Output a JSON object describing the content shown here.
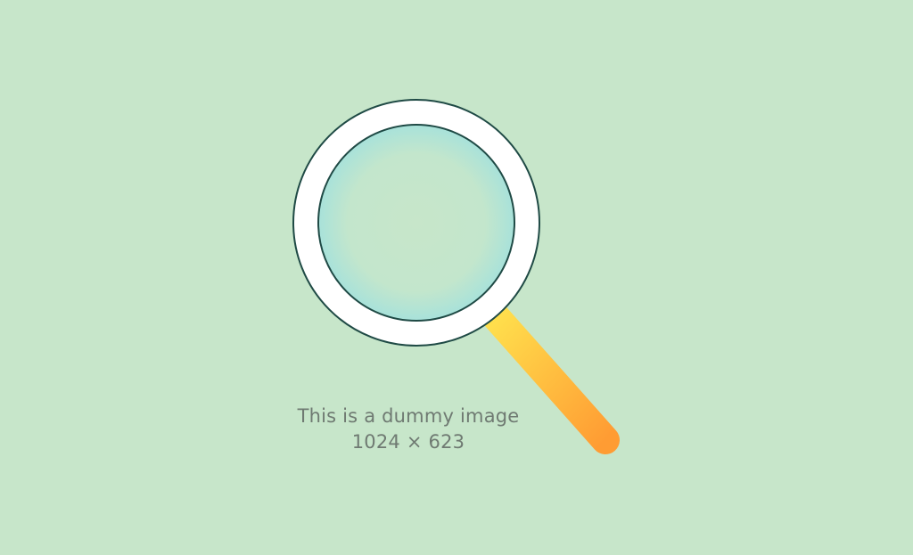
{
  "placeholder": {
    "line1": "This is a dummy image",
    "line2": "1024 × 623"
  },
  "colors": {
    "background": "#c7e6ca",
    "lens_rim": "#ffffff",
    "lens_outline": "#1f4a45",
    "lens_glass_edge": "#a8e2da",
    "lens_glass_center": "#c7e6ca",
    "handle_start": "#ffe14d",
    "handle_end": "#ff9c33",
    "caption_text": "#6f7a72"
  },
  "icon": "magnifying-glass-icon"
}
